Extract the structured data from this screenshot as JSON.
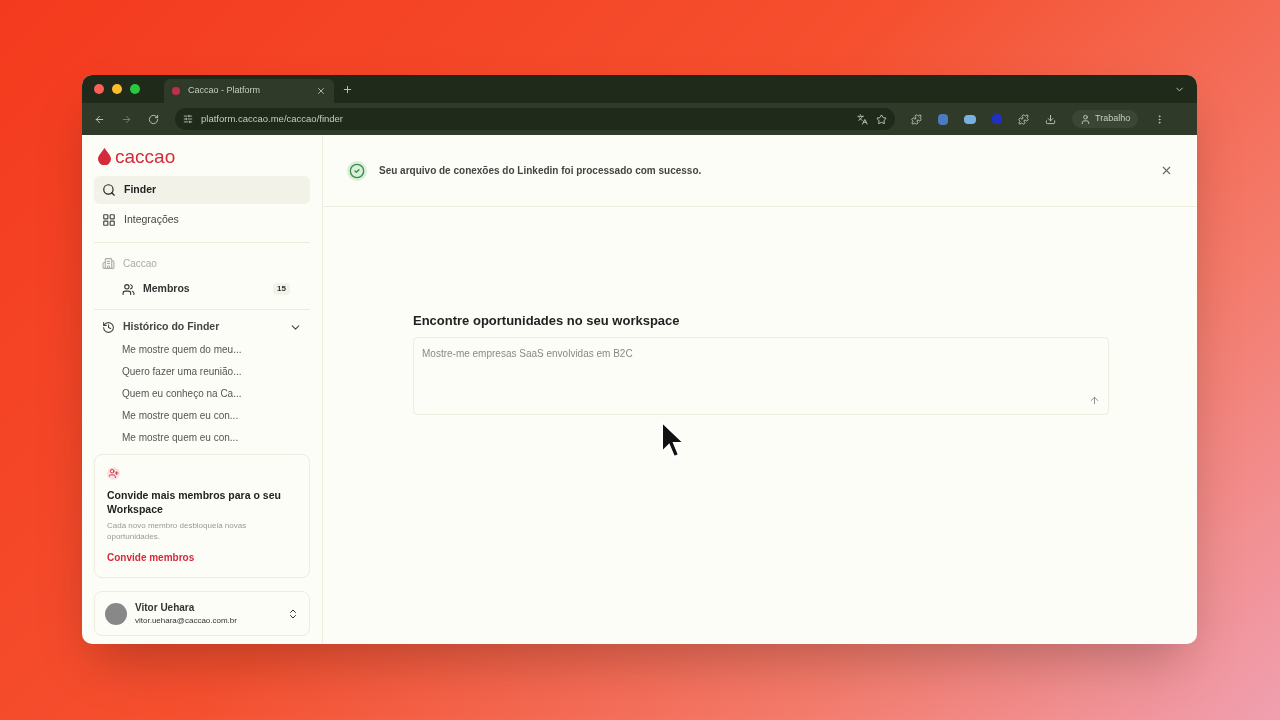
{
  "browser": {
    "tab_title": "Caccao - Platform",
    "url": "platform.caccao.me/caccao/finder",
    "profile": "Trabalho"
  },
  "sidebar": {
    "logo": "caccao",
    "nav": [
      {
        "label": "Finder",
        "kind": "search",
        "selected": true
      },
      {
        "label": "Integrações",
        "kind": "grid",
        "selected": false
      }
    ],
    "workspace": {
      "name": "Caccao",
      "members": {
        "label": "Membros",
        "count": "15"
      }
    },
    "history": {
      "title": "Histórico do Finder",
      "expanded": true,
      "items": [
        "Me mostre quem do meu...",
        "Quero fazer uma reunião...",
        "Quem eu conheço na Ca...",
        "Me mostre quem eu con...",
        "Me mostre quem eu con..."
      ]
    },
    "invite": {
      "title": "Convide mais membros para o seu Workspace",
      "text": "Cada novo membro desbloqueia novas oportunidades.",
      "link": "Convide membros"
    },
    "user": {
      "name": "Vitor Uehara",
      "email": "vitor.uehara@caccao.com.br"
    }
  },
  "notice": {
    "text": "Seu arquivo de conexões do Linkedin foi processado com sucesso."
  },
  "finder": {
    "heading": "Encontre oportunidades no seu workspace",
    "placeholder": "Mostre-me empresas SaaS envolvidas em B2C"
  }
}
